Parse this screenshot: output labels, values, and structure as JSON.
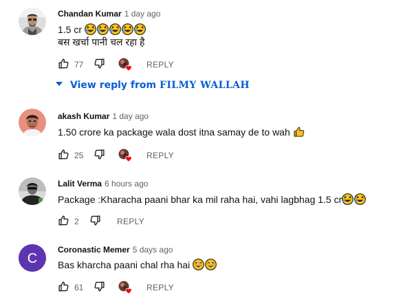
{
  "comments": [
    {
      "author": "Chandan Kumar",
      "time": "1 day ago",
      "line1_text": "1.5 cr",
      "line1_emoji": [
        "laughing-face",
        "laughing-face",
        "laughing-face",
        "laughing-face",
        "laughing-face"
      ],
      "line2_text": "बस खर्चा पानी चल रहा है",
      "likes": "77",
      "reply_label": "REPLY",
      "creator_heart": true,
      "avatar": {
        "kind": "photo",
        "colors": [
          "#7a7a7a",
          "#3d3d3d",
          "#e8e8e8"
        ]
      }
    },
    {
      "author": "akash Kumar",
      "time": "1 day ago",
      "line1_text": "1.50 crore ka package wala dost itna samay de to wah",
      "line1_emoji": [
        "thumbs-up"
      ],
      "likes": "25",
      "reply_label": "REPLY",
      "creator_heart": true,
      "avatar": {
        "kind": "photo",
        "colors": [
          "#e98f82",
          "#c0785a",
          "#2a2a2a"
        ]
      }
    },
    {
      "author": "Lalit Verma",
      "time": "6 hours ago",
      "line1_text": "Package :Kharacha paani bhar ka mil raha hai, vahi lagbhag 1.5 cr",
      "line1_emoji": [
        "laughing-face",
        "laughing-face"
      ],
      "likes": "2",
      "reply_label": "REPLY",
      "creator_heart": false,
      "avatar": {
        "kind": "photo",
        "colors": [
          "#222222",
          "#6d6d6d",
          "#4f8f4f"
        ]
      }
    },
    {
      "author": "Coronastic Memer",
      "time": "5 days ago",
      "line1_text": "Bas kharcha paani chal rha hai",
      "line1_emoji": [
        "grinning-face",
        "grinning-face"
      ],
      "likes": "61",
      "reply_label": "REPLY",
      "creator_heart": true,
      "avatar": {
        "kind": "letter",
        "letter": "C",
        "colors": [
          "#5e35b1",
          "#ffffff"
        ]
      }
    }
  ],
  "view_replies": {
    "label": "View reply from",
    "from": "FILMY WALLAH",
    "icon": "caret-down-icon"
  },
  "colors": {
    "accent": "#065fd4",
    "secondary_text": "#606060",
    "heart": "#ff0000"
  }
}
